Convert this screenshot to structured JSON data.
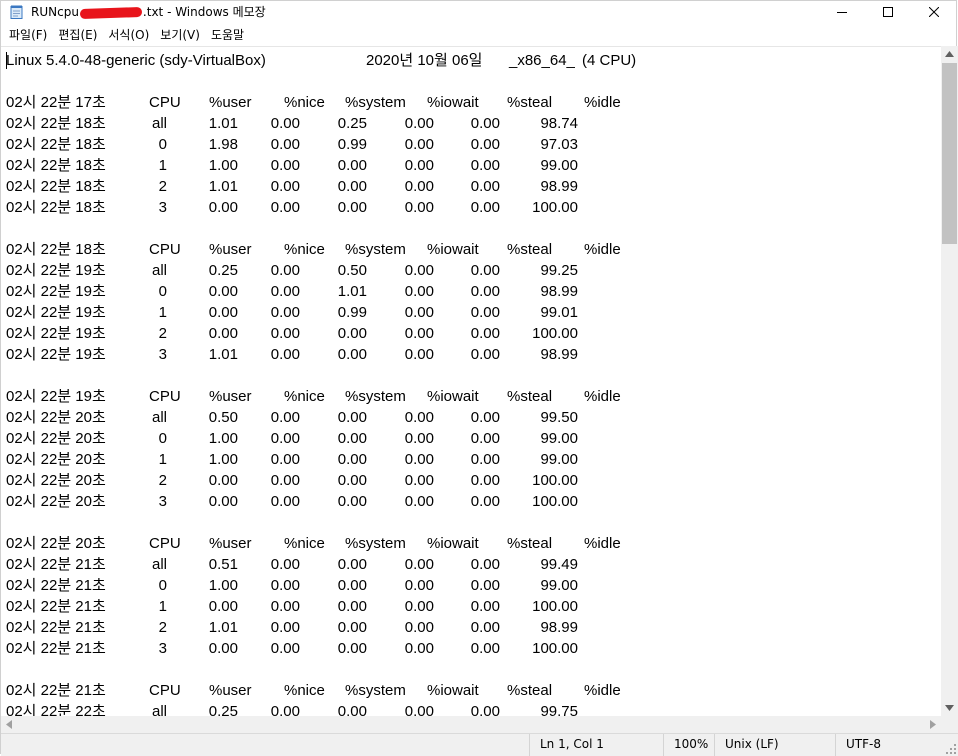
{
  "window": {
    "title_prefix": "RUNcpu",
    "title_suffix": ".txt - Windows 메모장"
  },
  "menu": [
    "파일(F)",
    "편집(E)",
    "서식(O)",
    "보기(V)",
    "도움말"
  ],
  "header_line": {
    "kernel": "Linux 5.4.0-48-generic (sdy-VirtualBox)",
    "date": "2020년 10월 06일",
    "arch": "_x86_64_",
    "cpus": "(4 CPU)"
  },
  "blocks": [
    {
      "header": [
        "02시 22분 17초",
        "CPU",
        "%user",
        "%nice",
        "%system",
        "%iowait",
        "%steal",
        "%idle"
      ],
      "rows": [
        [
          "02시 22분 18초",
          "all",
          "1.01",
          "0.00",
          "0.25",
          "0.00",
          "0.00",
          "98.74"
        ],
        [
          "02시 22분 18초",
          "0",
          "1.98",
          "0.00",
          "0.99",
          "0.00",
          "0.00",
          "97.03"
        ],
        [
          "02시 22분 18초",
          "1",
          "1.00",
          "0.00",
          "0.00",
          "0.00",
          "0.00",
          "99.00"
        ],
        [
          "02시 22분 18초",
          "2",
          "1.01",
          "0.00",
          "0.00",
          "0.00",
          "0.00",
          "98.99"
        ],
        [
          "02시 22분 18초",
          "3",
          "0.00",
          "0.00",
          "0.00",
          "0.00",
          "0.00",
          "100.00"
        ]
      ]
    },
    {
      "header": [
        "02시 22분 18초",
        "CPU",
        "%user",
        "%nice",
        "%system",
        "%iowait",
        "%steal",
        "%idle"
      ],
      "rows": [
        [
          "02시 22분 19초",
          "all",
          "0.25",
          "0.00",
          "0.50",
          "0.00",
          "0.00",
          "99.25"
        ],
        [
          "02시 22분 19초",
          "0",
          "0.00",
          "0.00",
          "1.01",
          "0.00",
          "0.00",
          "98.99"
        ],
        [
          "02시 22분 19초",
          "1",
          "0.00",
          "0.00",
          "0.99",
          "0.00",
          "0.00",
          "99.01"
        ],
        [
          "02시 22분 19초",
          "2",
          "0.00",
          "0.00",
          "0.00",
          "0.00",
          "0.00",
          "100.00"
        ],
        [
          "02시 22분 19초",
          "3",
          "1.01",
          "0.00",
          "0.00",
          "0.00",
          "0.00",
          "98.99"
        ]
      ]
    },
    {
      "header": [
        "02시 22분 19초",
        "CPU",
        "%user",
        "%nice",
        "%system",
        "%iowait",
        "%steal",
        "%idle"
      ],
      "rows": [
        [
          "02시 22분 20초",
          "all",
          "0.50",
          "0.00",
          "0.00",
          "0.00",
          "0.00",
          "99.50"
        ],
        [
          "02시 22분 20초",
          "0",
          "1.00",
          "0.00",
          "0.00",
          "0.00",
          "0.00",
          "99.00"
        ],
        [
          "02시 22분 20초",
          "1",
          "1.00",
          "0.00",
          "0.00",
          "0.00",
          "0.00",
          "99.00"
        ],
        [
          "02시 22분 20초",
          "2",
          "0.00",
          "0.00",
          "0.00",
          "0.00",
          "0.00",
          "100.00"
        ],
        [
          "02시 22분 20초",
          "3",
          "0.00",
          "0.00",
          "0.00",
          "0.00",
          "0.00",
          "100.00"
        ]
      ]
    },
    {
      "header": [
        "02시 22분 20초",
        "CPU",
        "%user",
        "%nice",
        "%system",
        "%iowait",
        "%steal",
        "%idle"
      ],
      "rows": [
        [
          "02시 22분 21초",
          "all",
          "0.51",
          "0.00",
          "0.00",
          "0.00",
          "0.00",
          "99.49"
        ],
        [
          "02시 22분 21초",
          "0",
          "1.00",
          "0.00",
          "0.00",
          "0.00",
          "0.00",
          "99.00"
        ],
        [
          "02시 22분 21초",
          "1",
          "0.00",
          "0.00",
          "0.00",
          "0.00",
          "0.00",
          "100.00"
        ],
        [
          "02시 22분 21초",
          "2",
          "1.01",
          "0.00",
          "0.00",
          "0.00",
          "0.00",
          "98.99"
        ],
        [
          "02시 22분 21초",
          "3",
          "0.00",
          "0.00",
          "0.00",
          "0.00",
          "0.00",
          "100.00"
        ]
      ]
    },
    {
      "header": [
        "02시 22분 21초",
        "CPU",
        "%user",
        "%nice",
        "%system",
        "%iowait",
        "%steal",
        "%idle"
      ],
      "rows": [
        [
          "02시 22분 22초",
          "all",
          "0.25",
          "0.00",
          "0.00",
          "0.00",
          "0.00",
          "99.75"
        ]
      ]
    }
  ],
  "status": {
    "position": "Ln 1, Col 1",
    "zoom": "100%",
    "line_ending": "Unix (LF)",
    "encoding": "UTF-8"
  },
  "colors": {
    "redaction": "#e8141b",
    "scrollbar_thumb": "#c2c2c2",
    "chrome_bg": "#f0f0f0"
  }
}
